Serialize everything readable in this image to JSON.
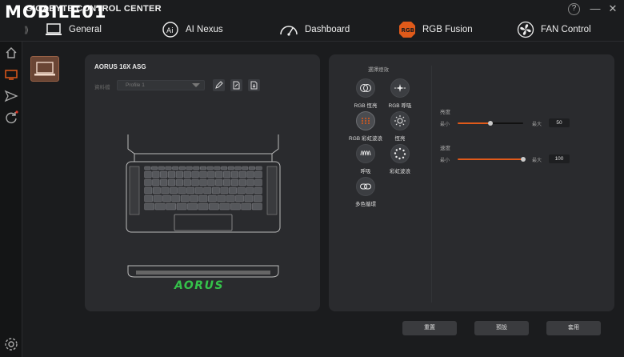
{
  "titlebar": {
    "watermark": "MOBILE01",
    "app_title": "GIGABYTE CONTROL CENTER",
    "help": "?",
    "minimize": "—",
    "close": "✕"
  },
  "topnav": {
    "collapse": "⟫",
    "items": [
      {
        "label": "General",
        "icon": "laptop-icon"
      },
      {
        "label": "AI Nexus",
        "icon": "ai-icon"
      },
      {
        "label": "Dashboard",
        "icon": "gauge-icon"
      },
      {
        "label": "RGB Fusion",
        "icon": "rgb-icon"
      },
      {
        "label": "FAN Control",
        "icon": "fan-icon"
      }
    ]
  },
  "sidebar": {
    "icons": [
      "home-icon",
      "monitor-icon",
      "send-icon",
      "refresh-icon",
      "settings-icon"
    ]
  },
  "device": {
    "name": "AORUS 16X ASG",
    "profile_label": "資料檔",
    "profile_value": "Profile 1",
    "logo_text": "AORUS"
  },
  "effects": {
    "title": "選擇燈效",
    "items": [
      {
        "label": "RGB 恆亮"
      },
      {
        "label": "RGB 呼吸"
      },
      {
        "label": "RGB 彩虹波浪"
      },
      {
        "label": "恆亮"
      },
      {
        "label": "呼吸"
      },
      {
        "label": "彩虹波浪"
      },
      {
        "label": "多色循環"
      }
    ],
    "selected": 2
  },
  "brightness": {
    "title": "亮度",
    "min_label": "最小",
    "max_label": "最大",
    "value": "50",
    "fraction": 0.5
  },
  "speed": {
    "title": "速度",
    "min_label": "最小",
    "max_label": "最大",
    "value": "100",
    "fraction": 1.0
  },
  "actions": {
    "reset": "重置",
    "default": "預設",
    "apply": "套用"
  },
  "colors": {
    "accent": "#e05a1a",
    "panel": "#2a2b2e",
    "background": "#1b1c1e",
    "logo_green": "#35c24a"
  }
}
